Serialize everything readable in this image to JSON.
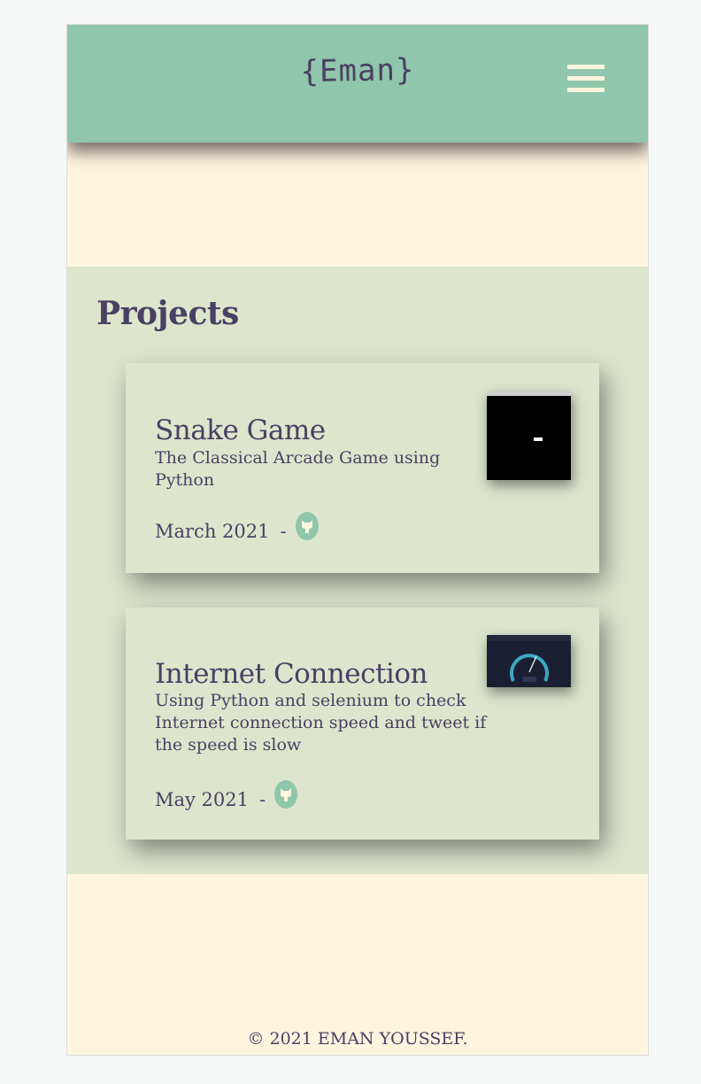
{
  "header": {
    "logo": "{Eman}",
    "menu_icon": "hamburger-menu-icon"
  },
  "projects": {
    "title": "Projects",
    "items": [
      {
        "title": "Snake Game",
        "description": "The Classical Arcade Game using Python",
        "date": "March 2021",
        "separator": "-",
        "link_icon": "github-icon",
        "thumbnail": "snake-game-screenshot"
      },
      {
        "title": "Internet Connection",
        "description": "Using Python and selenium to check Internet connection speed and tweet if the speed is slow",
        "date": "May 2021",
        "separator": "-",
        "link_icon": "github-icon",
        "thumbnail": "speedtest-screenshot"
      }
    ]
  },
  "footer": {
    "copyright": "© 2021 EMAN YOUSSEF."
  },
  "colors": {
    "header_bg": "#90c6ab",
    "page_bg": "#fdf5de",
    "section_bg": "#dde6cd",
    "text": "#4a4063"
  }
}
